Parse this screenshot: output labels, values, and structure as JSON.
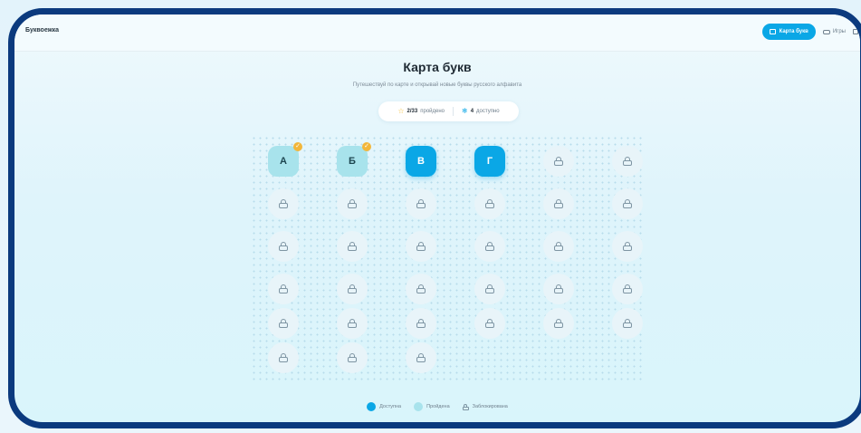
{
  "app": {
    "brand": "Буквоежка"
  },
  "nav": {
    "items": [
      {
        "label": "Карта букв",
        "icon": "map-icon",
        "active": true
      },
      {
        "label": "Игры",
        "icon": "gamepad-icon",
        "active": false
      }
    ]
  },
  "page": {
    "title": "Карта букв",
    "subtitle": "Путешествуй по карте и открывай новые буквы русского алфавита"
  },
  "stats": {
    "passed_value": "2/33",
    "passed_label": "пройдено",
    "available_value": "4",
    "available_label": "доступно"
  },
  "letters": {
    "a": "А",
    "b": "Б",
    "v": "В",
    "g": "Г"
  },
  "legend": {
    "available": "Доступна",
    "passed": "Пройдена",
    "locked": "Заблокирована"
  },
  "colors": {
    "accent": "#0aa7e6",
    "passed": "#a8e3ec",
    "frame": "#0b3a7e",
    "check": "#f2b63a"
  },
  "map": {
    "total_letters": 33,
    "passed_letters": [
      "А",
      "Б"
    ],
    "available_letters": [
      "В",
      "Г"
    ]
  }
}
